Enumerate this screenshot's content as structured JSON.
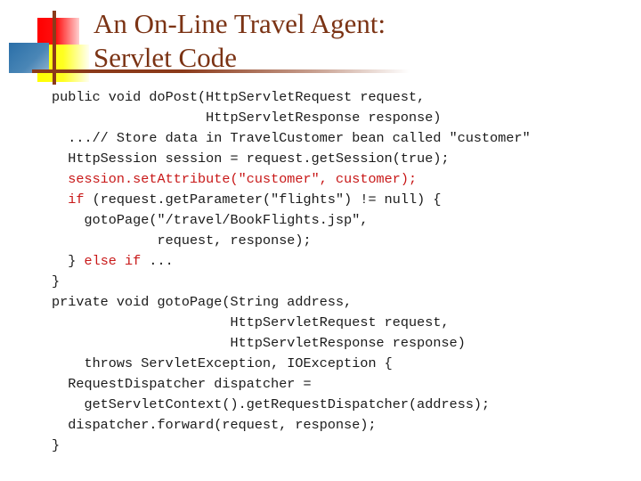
{
  "slide": {
    "title_line1": "An On-Line Travel Agent:",
    "title_line2": "Servlet Code",
    "accent_colors": {
      "title": "#7b3314",
      "highlight_code": "#c81818",
      "logo_red": "#ff0000",
      "logo_yellow": "#ffff00",
      "logo_blue": "#2a6fa8",
      "rule": "#8b3a1a"
    }
  },
  "code": {
    "lines": [
      {
        "text": "public void doPost(HttpServletRequest request,",
        "highlight": false
      },
      {
        "text": "                   HttpServletResponse response)",
        "highlight": false
      },
      {
        "text": "  ...// Store data in TravelCustomer bean called \"customer\"",
        "highlight": false
      },
      {
        "text": "  HttpSession session = request.getSession(true);",
        "highlight": false
      },
      {
        "text": "  session.setAttribute(\"customer\", customer);",
        "highlight": true
      },
      {
        "text_parts": [
          {
            "t": "  ",
            "r": false
          },
          {
            "t": "if",
            "r": true
          },
          {
            "t": " (request.getParameter(\"flights\") != null) {",
            "r": false
          }
        ]
      },
      {
        "text": "    gotoPage(\"/travel/BookFlights.jsp\",",
        "highlight": false
      },
      {
        "text": "             request, response);",
        "highlight": false
      },
      {
        "text_parts": [
          {
            "t": "  } ",
            "r": false
          },
          {
            "t": "else if",
            "r": true
          },
          {
            "t": " ...",
            "r": false
          }
        ]
      },
      {
        "text": "}",
        "highlight": false
      },
      {
        "text": "private void gotoPage(String address,",
        "highlight": false
      },
      {
        "text": "                      HttpServletRequest request,",
        "highlight": false
      },
      {
        "text": "                      HttpServletResponse response)",
        "highlight": false
      },
      {
        "text": "    throws ServletException, IOException {",
        "highlight": false
      },
      {
        "text": "  RequestDispatcher dispatcher =",
        "highlight": false
      },
      {
        "text": "    getServletContext().getRequestDispatcher(address);",
        "highlight": false
      },
      {
        "text": "  dispatcher.forward(request, response);",
        "highlight": false
      },
      {
        "text": "}",
        "highlight": false
      }
    ]
  }
}
